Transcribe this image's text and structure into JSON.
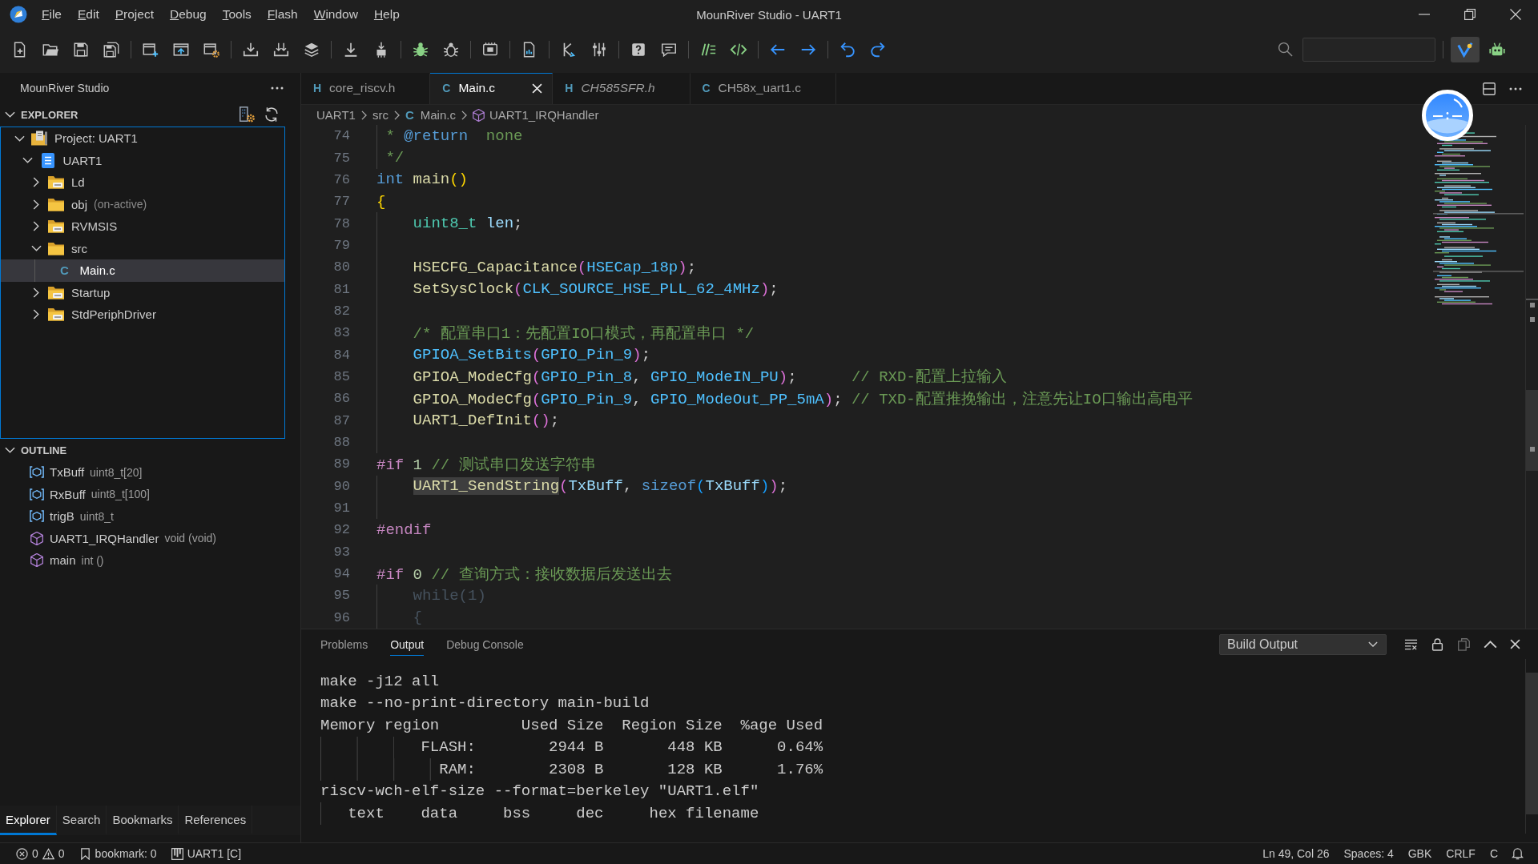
{
  "title_bar": {
    "menus": [
      "File",
      "Edit",
      "Project",
      "Debug",
      "Tools",
      "Flash",
      "Window",
      "Help"
    ],
    "title": "MounRiver Studio - UART1"
  },
  "toolbar": {
    "groups": [
      [
        {
          "kind": "new-file"
        },
        {
          "kind": "open-folder"
        },
        {
          "kind": "save"
        },
        {
          "kind": "save-all"
        }
      ],
      [
        {
          "kind": "new-window"
        },
        {
          "kind": "window-arrow"
        },
        {
          "kind": "window-gear"
        }
      ],
      [
        {
          "kind": "download"
        },
        {
          "kind": "download-double"
        },
        {
          "kind": "layers"
        }
      ],
      [
        {
          "kind": "download-bar"
        },
        {
          "kind": "chip-arrow"
        }
      ],
      [
        {
          "kind": "bug"
        },
        {
          "kind": "bug-outline"
        }
      ],
      [
        {
          "kind": "board"
        }
      ],
      [
        {
          "kind": "document-chart"
        }
      ],
      [
        {
          "kind": "fork"
        },
        {
          "kind": "sliders"
        }
      ],
      [
        {
          "kind": "help"
        },
        {
          "kind": "chat"
        }
      ],
      [
        {
          "kind": "comment-lines"
        },
        {
          "kind": "code"
        }
      ],
      [
        {
          "kind": "arrow-left"
        },
        {
          "kind": "arrow-right"
        }
      ],
      [
        {
          "kind": "undo"
        },
        {
          "kind": "redo"
        }
      ]
    ],
    "right_tools": [
      {
        "kind": "checkmark",
        "on": true
      },
      {
        "kind": "robot",
        "on": false
      }
    ]
  },
  "sidebar": {
    "title": "MounRiver Studio",
    "explorer": {
      "title": "EXPLORER",
      "expanded": true,
      "tree": [
        {
          "label": "Project: UART1",
          "kind": "project",
          "expanded": true,
          "selected": false,
          "children": [
            {
              "label": "UART1",
              "kind": "application",
              "expanded": true,
              "selected": false,
              "children": [
                {
                  "label": "Ld",
                  "kind": "source-folder",
                  "expanded": false,
                  "selected": false
                },
                {
                  "label": "obj",
                  "detail": "(on-active)",
                  "kind": "folder",
                  "expanded": false,
                  "selected": false
                },
                {
                  "label": "RVMSIS",
                  "kind": "source-folder",
                  "expanded": false,
                  "selected": false
                },
                {
                  "label": "src",
                  "kind": "folder",
                  "expanded": true,
                  "selected": false,
                  "children": [
                    {
                      "label": "Main.c",
                      "kind": "file",
                      "glyph": "C",
                      "selected": true
                    }
                  ]
                },
                {
                  "label": "Startup",
                  "kind": "source-folder",
                  "expanded": false,
                  "selected": false
                },
                {
                  "label": "StdPeriphDriver",
                  "kind": "source-folder",
                  "expanded": false,
                  "selected": false
                }
              ]
            }
          ]
        }
      ]
    },
    "outline": {
      "title": "OUTLINE",
      "expanded": true,
      "items": [
        {
          "name": "TxBuff",
          "detail": "uint8_t[20]",
          "kind": "variable"
        },
        {
          "name": "RxBuff",
          "detail": "uint8_t[100]",
          "kind": "variable"
        },
        {
          "name": "trigB",
          "detail": "uint8_t",
          "kind": "variable"
        },
        {
          "name": "UART1_IRQHandler",
          "detail": "void (void)",
          "kind": "function"
        },
        {
          "name": "main",
          "detail": "int ()",
          "kind": "function"
        }
      ]
    },
    "tabs": [
      {
        "label": "Explorer",
        "selected": true
      },
      {
        "label": "Search",
        "selected": false
      },
      {
        "label": "Bookmarks",
        "selected": false
      },
      {
        "label": "References",
        "selected": false
      }
    ]
  },
  "editor": {
    "tabs": [
      {
        "glyph": "H",
        "label": "core_riscv.h",
        "selected": false,
        "preview": false
      },
      {
        "glyph": "C",
        "label": "Main.c",
        "selected": true,
        "preview": false
      },
      {
        "glyph": "H",
        "label": "CH585SFR.h",
        "selected": false,
        "preview": true
      },
      {
        "glyph": "C",
        "label": "CH58x_uart1.c",
        "selected": false,
        "preview": false
      }
    ],
    "breadcrumb": [
      {
        "label": "UART1",
        "kind": "folder"
      },
      {
        "label": "src",
        "kind": "folder"
      },
      {
        "label": "Main.c",
        "kind": "file",
        "glyph": "C"
      },
      {
        "label": "UART1_IRQHandler",
        "kind": "function"
      }
    ],
    "lines": [
      {
        "number": "74",
        "tokens": [
          {
            "text": " * ",
            "kind": "comment"
          },
          {
            "text": "@return",
            "kind": "doc-tag"
          },
          {
            "text": "  none",
            "kind": "comment"
          }
        ]
      },
      {
        "number": "75",
        "tokens": [
          {
            "text": " */",
            "kind": "comment"
          }
        ]
      },
      {
        "number": "76",
        "tokens": [
          {
            "text": "int ",
            "kind": "keyword"
          },
          {
            "text": "main",
            "kind": "function"
          },
          {
            "text": "()",
            "kind": "bracket-1"
          }
        ]
      },
      {
        "number": "77",
        "tokens": [
          {
            "text": "{",
            "kind": "bracket-1"
          }
        ]
      },
      {
        "number": "78",
        "tokens": [
          {
            "text": "    uint8_t",
            "kind": "type"
          },
          {
            "text": " len",
            "kind": "variable"
          },
          {
            "text": ";",
            "kind": "plain"
          }
        ]
      },
      {
        "number": "79"
      },
      {
        "number": "80",
        "tokens": [
          {
            "text": "    HSECFG_Capacitance",
            "kind": "function"
          },
          {
            "text": "(",
            "kind": "bracket-2"
          },
          {
            "text": "HSECap_18p",
            "kind": "macro"
          },
          {
            "text": ")",
            "kind": "bracket-2"
          },
          {
            "text": ";",
            "kind": "plain"
          }
        ]
      },
      {
        "number": "81",
        "tokens": [
          {
            "text": "    SetSysClock",
            "kind": "function"
          },
          {
            "text": "(",
            "kind": "bracket-2"
          },
          {
            "text": "CLK_SOURCE_HSE_PLL_62_4MHz",
            "kind": "macro"
          },
          {
            "text": ")",
            "kind": "bracket-2"
          },
          {
            "text": ";",
            "kind": "plain"
          }
        ]
      },
      {
        "number": "82"
      },
      {
        "number": "83",
        "tokens": [
          {
            "text": "    /* 配置串口1：先配置IO口模式，再配置串口 */",
            "kind": "comment"
          }
        ]
      },
      {
        "number": "84",
        "tokens": [
          {
            "text": "    GPIOA_SetBits",
            "kind": "macro"
          },
          {
            "text": "(",
            "kind": "bracket-2"
          },
          {
            "text": "GPIO_Pin_9",
            "kind": "macro"
          },
          {
            "text": ")",
            "kind": "bracket-2"
          },
          {
            "text": ";",
            "kind": "plain"
          }
        ]
      },
      {
        "number": "85",
        "tokens": [
          {
            "text": "    GPIOA_ModeCfg",
            "kind": "function"
          },
          {
            "text": "(",
            "kind": "bracket-2"
          },
          {
            "text": "GPIO_Pin_8",
            "kind": "macro"
          },
          {
            "text": ", ",
            "kind": "plain"
          },
          {
            "text": "GPIO_ModeIN_PU",
            "kind": "macro"
          },
          {
            "text": ")",
            "kind": "bracket-2"
          },
          {
            "text": ";      ",
            "kind": "plain"
          },
          {
            "text": "// RXD-配置上拉输入",
            "kind": "comment"
          }
        ]
      },
      {
        "number": "86",
        "tokens": [
          {
            "text": "    GPIOA_ModeCfg",
            "kind": "function"
          },
          {
            "text": "(",
            "kind": "bracket-2"
          },
          {
            "text": "GPIO_Pin_9",
            "kind": "macro"
          },
          {
            "text": ", ",
            "kind": "plain"
          },
          {
            "text": "GPIO_ModeOut_PP_5mA",
            "kind": "macro"
          },
          {
            "text": ")",
            "kind": "bracket-2"
          },
          {
            "text": "; ",
            "kind": "plain"
          },
          {
            "text": "// TXD-配置推挽输出，注意先让IO口输出高电平",
            "kind": "comment"
          }
        ]
      },
      {
        "number": "87",
        "tokens": [
          {
            "text": "    UART1_DefInit",
            "kind": "function"
          },
          {
            "text": "()",
            "kind": "bracket-2"
          },
          {
            "text": ";",
            "kind": "plain"
          }
        ]
      },
      {
        "number": "88"
      },
      {
        "number": "89",
        "tokens": [
          {
            "text": "#if ",
            "kind": "preprocessor"
          },
          {
            "text": "1 ",
            "kind": "number"
          },
          {
            "text": "// 测试串口发送字符串",
            "kind": "comment"
          }
        ]
      },
      {
        "number": "90",
        "tokens": [
          {
            "text": "    UART1_SendString",
            "kind": "function",
            "highlighted": true
          },
          {
            "text": "(",
            "kind": "bracket-2"
          },
          {
            "text": "TxBuff",
            "kind": "variable"
          },
          {
            "text": ", ",
            "kind": "plain"
          },
          {
            "text": "sizeof",
            "kind": "keyword"
          },
          {
            "text": "(",
            "kind": "bracket-3"
          },
          {
            "text": "TxBuff",
            "kind": "variable"
          },
          {
            "text": ")",
            "kind": "bracket-3"
          },
          {
            "text": ")",
            "kind": "bracket-2"
          },
          {
            "text": ";",
            "kind": "plain"
          }
        ]
      },
      {
        "number": "91"
      },
      {
        "number": "92",
        "tokens": [
          {
            "text": "#endif",
            "kind": "preprocessor"
          }
        ]
      },
      {
        "number": "93"
      },
      {
        "number": "94",
        "tokens": [
          {
            "text": "#if ",
            "kind": "preprocessor"
          },
          {
            "text": "0 ",
            "kind": "number"
          },
          {
            "text": "// 查询方式：接收数据后发送出去",
            "kind": "comment"
          }
        ]
      },
      {
        "number": "95",
        "tokens": [
          {
            "text": "    while(1)",
            "kind": "inactive"
          }
        ]
      },
      {
        "number": "96",
        "tokens": [
          {
            "text": "    {",
            "kind": "inactive"
          }
        ]
      }
    ]
  },
  "panel": {
    "tabs": [
      {
        "label": "Problems",
        "selected": false
      },
      {
        "label": "Output",
        "selected": true
      },
      {
        "label": "Debug Console",
        "selected": false
      }
    ],
    "channel": "Build Output",
    "lines": [
      "make -j12 all",
      "make --no-print-directory main-build",
      "Memory region         Used Size  Region Size  %age Used",
      "           FLASH:        2944 B       448 KB      0.64%",
      "             RAM:        2308 B       128 KB      1.76%",
      "riscv-wch-elf-size --format=berkeley \"UART1.elf\"",
      "   text    data     bss     dec     hex filename"
    ]
  },
  "status_bar": {
    "errors": "0",
    "warnings": "0",
    "bookmarks": "bookmark: 0",
    "project": "UART1 [C]",
    "items": [
      "Ln 49, Col 26",
      "Spaces: 4",
      "GBK",
      "CRLF",
      "C"
    ]
  }
}
